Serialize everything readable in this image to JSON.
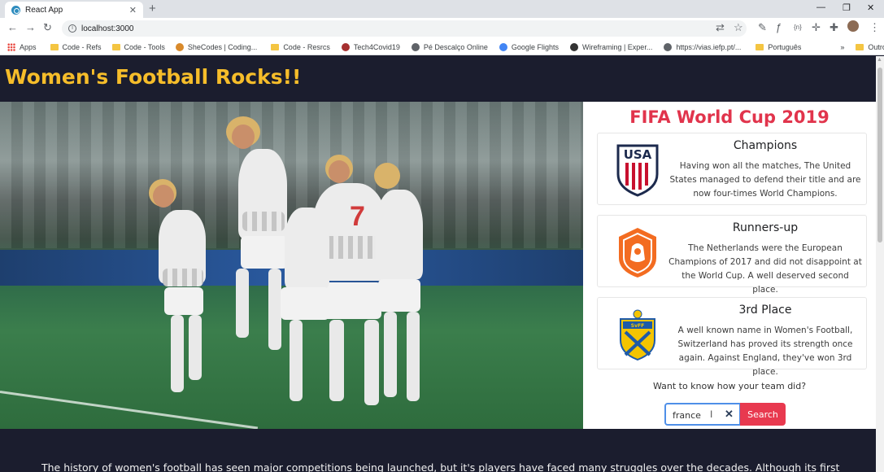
{
  "browser": {
    "tab_title": "React App",
    "url": "localhost:3000",
    "bookmarks": [
      {
        "label": "Apps",
        "icon": "apps-grid-icon"
      },
      {
        "label": "Code - Refs",
        "icon": "folder-icon"
      },
      {
        "label": "Code - Tools",
        "icon": "folder-icon"
      },
      {
        "label": "SheCodes | Coding...",
        "icon": "shecodes-icon"
      },
      {
        "label": "Code - Resrcs",
        "icon": "folder-icon"
      },
      {
        "label": "Tech4Covid19",
        "icon": "gear-icon"
      },
      {
        "label": "Pé Descalço Online",
        "icon": "globe-icon"
      },
      {
        "label": "Google Flights",
        "icon": "flight-icon"
      },
      {
        "label": "Wireframing | Exper...",
        "icon": "globe-icon"
      },
      {
        "label": "https://vias.iefp.pt/...",
        "icon": "globe-icon"
      },
      {
        "label": "Português",
        "icon": "folder-icon"
      }
    ],
    "bookmarks_overflow": "»",
    "other_bookmarks": "Outros favoritos"
  },
  "page": {
    "site_title": "Women's Football Rocks!!",
    "world_cup": {
      "title": "FIFA World Cup 2019",
      "cards": [
        {
          "title": "Champions",
          "text": "Having won all the matches, The United States managed to defend their title and are now four-times World Champions.",
          "crest": "usa-crest-icon"
        },
        {
          "title": "Runners-up",
          "text": "The Netherlands were the European Champions of 2017 and did not disappoint at the World Cup. A well deserved second place.",
          "crest": "netherlands-crest-icon"
        },
        {
          "title": "3rd Place",
          "text": "A well known name in Women's Football, Switzerland has proved its strength once again. Against England, they've won 3rd place.",
          "crest": "sweden-crest-icon"
        }
      ],
      "prompt": "Want to know how your team did?",
      "search_value": "france",
      "search_button": "Search"
    },
    "history_text": "The history of women's football has seen major competitions being launched, but it's players have faced many struggles over the decades. Although its first"
  },
  "colors": {
    "background": "#1b1d2e",
    "title_yellow": "#f6bd2a",
    "accent_red": "#e1344c",
    "button_red": "#e8394f",
    "focus_blue": "#4f8fe8"
  }
}
